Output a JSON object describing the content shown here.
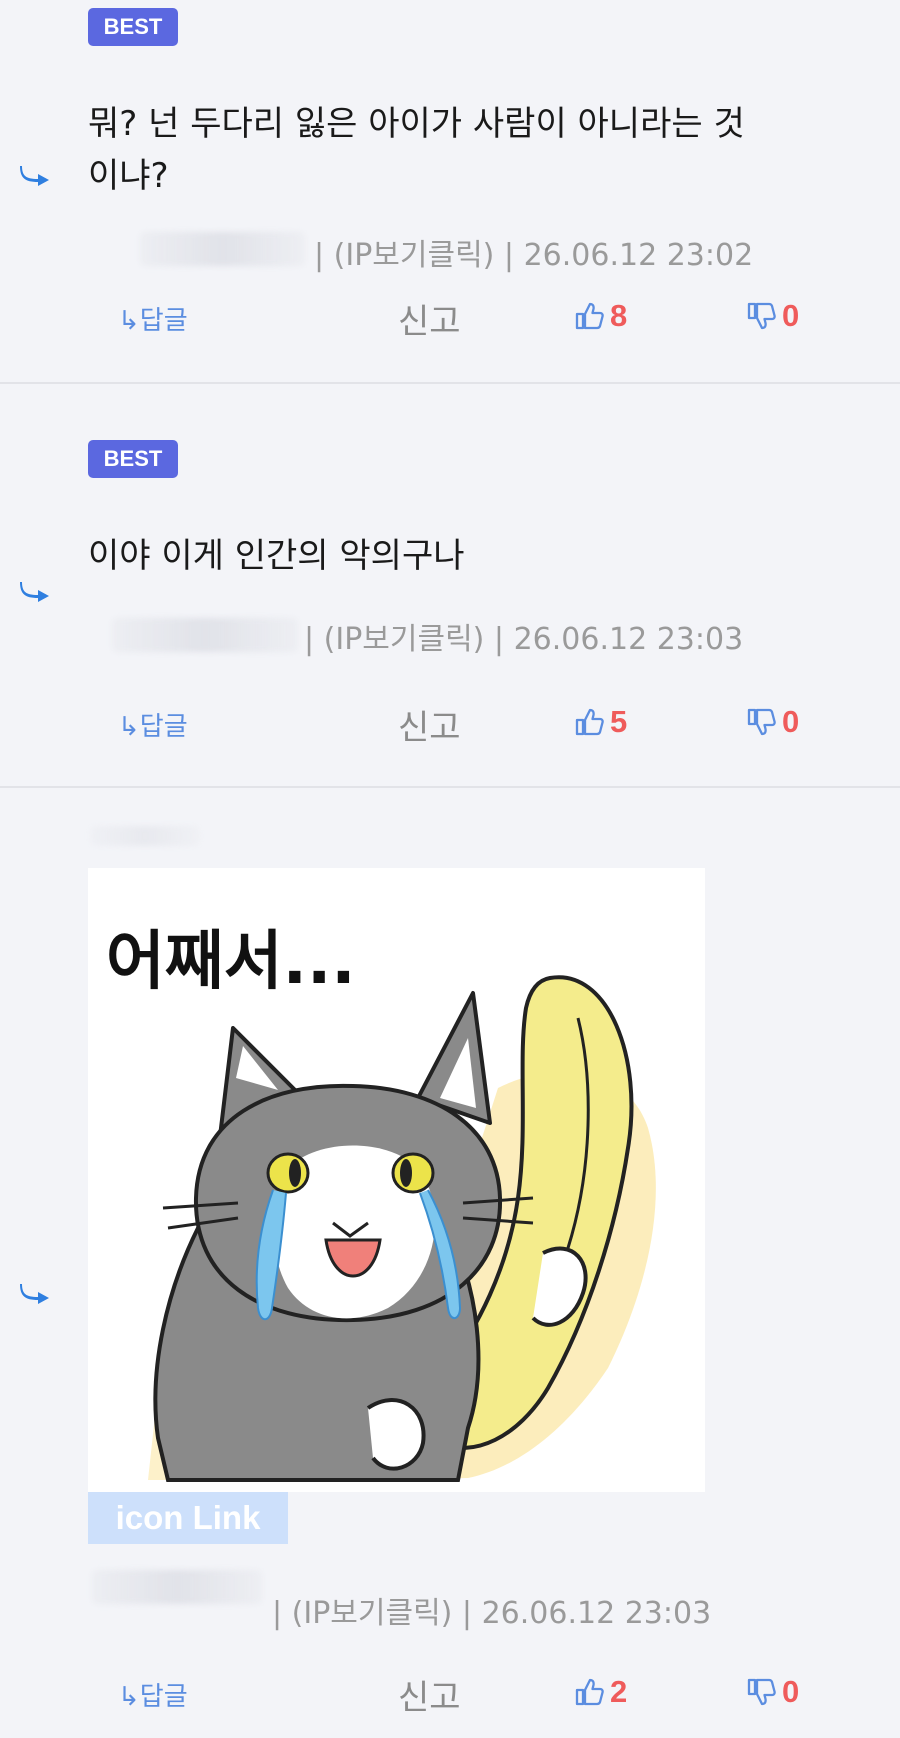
{
  "comments": [
    {
      "badge": "BEST",
      "text_line1": "뭐? 넌 두다리 잃은 아이가 사람이 아니라는 것",
      "text_line2": "이냐?",
      "meta": "| (IP보기클릭) | 26.06.12 23:02",
      "reply_label": "↳답글",
      "report_label": "신고",
      "likes": "8",
      "dislikes": "0"
    },
    {
      "badge": "BEST",
      "text_line1": "이야 이게 인간의 악의구나",
      "meta": "| (IP보기클릭) | 26.06.12 23:03",
      "reply_label": "↳답글",
      "report_label": "신고",
      "likes": "5",
      "dislikes": "0"
    },
    {
      "sticker_caption": "어째서...",
      "icon_link_label": "icon Link",
      "meta": "| (IP보기클릭) | 26.06.12 23:03",
      "reply_label": "↳답글",
      "report_label": "신고",
      "likes": "2",
      "dislikes": "0"
    }
  ],
  "colors": {
    "badge": "#5b68e0",
    "accent_blue": "#5b8de0",
    "count_red": "#ef5b5b",
    "background": "#f3f4f8"
  },
  "icons": [
    "reply-arrow-icon",
    "thumbs-up-icon",
    "thumbs-down-icon"
  ]
}
